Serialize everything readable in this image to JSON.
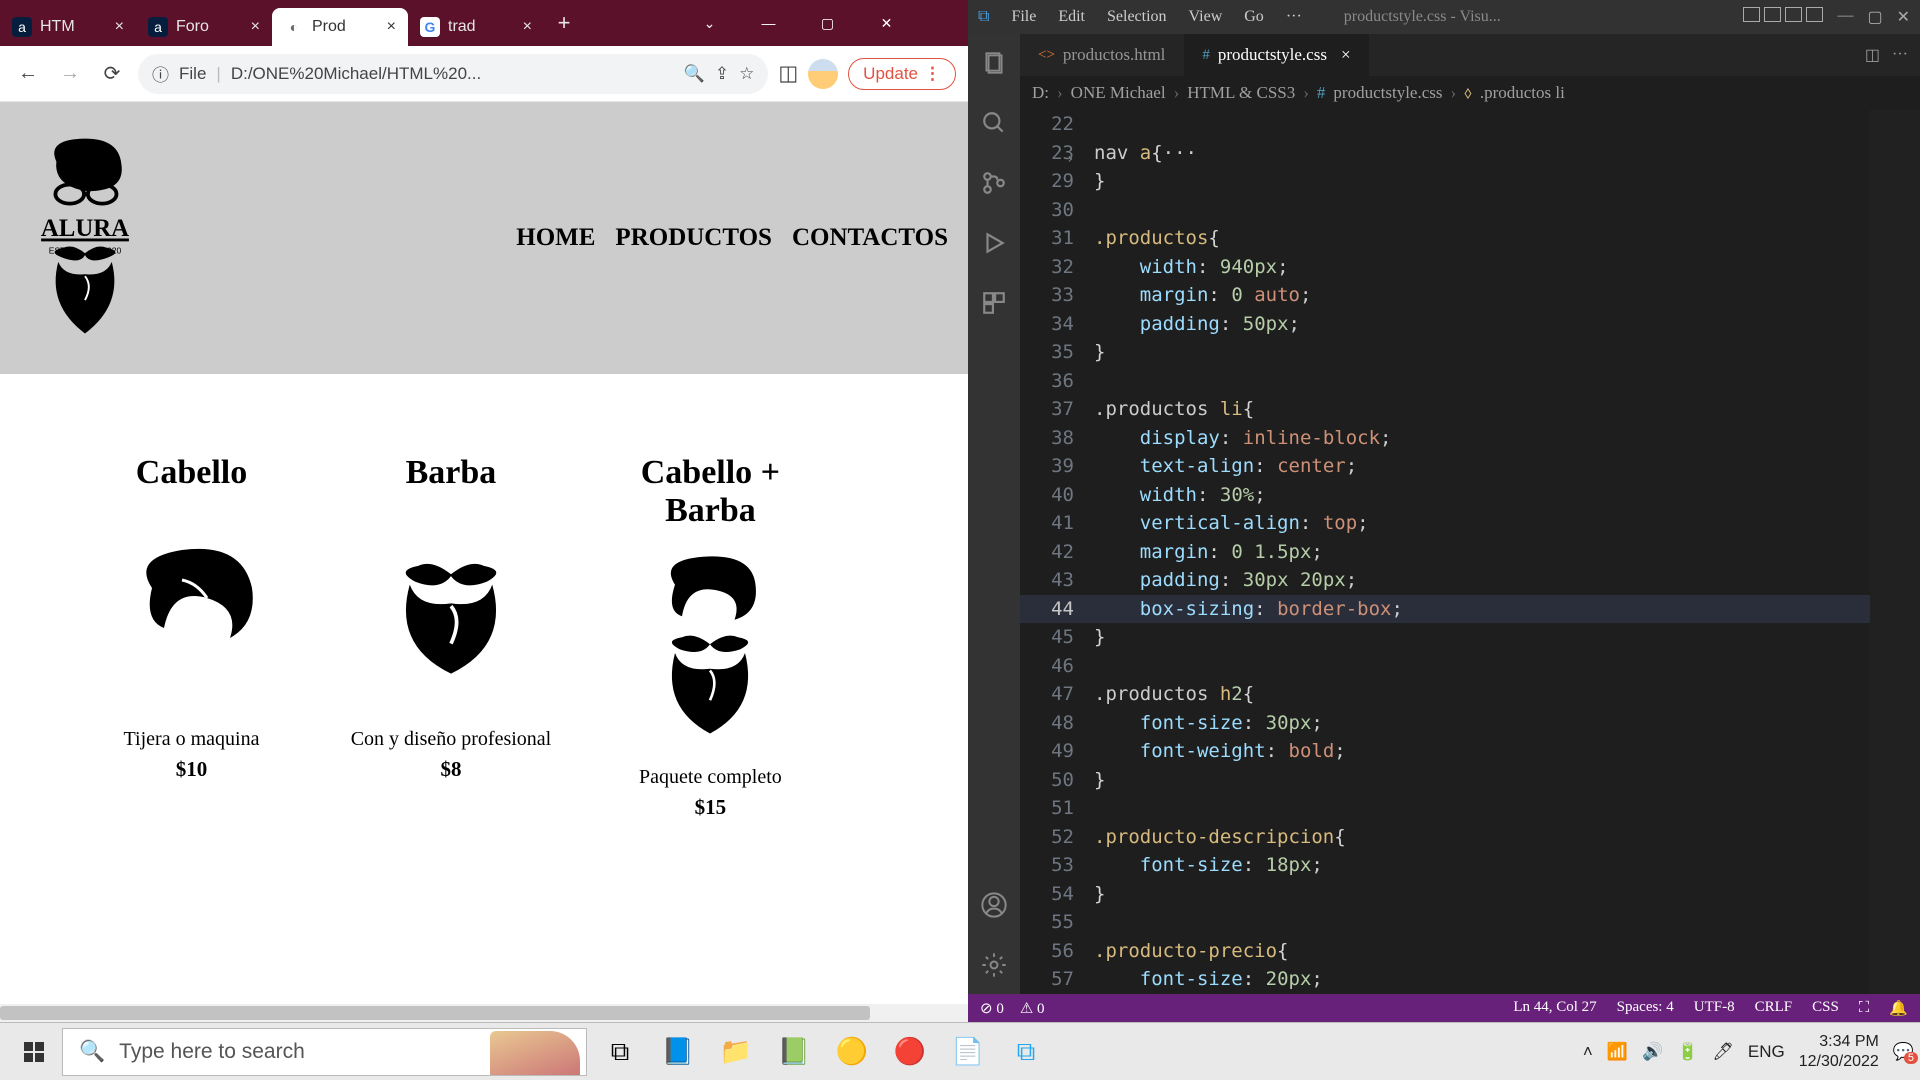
{
  "browser": {
    "tabs": [
      {
        "label": "HTM",
        "fav": "a"
      },
      {
        "label": "Foro",
        "fav": "a"
      },
      {
        "label": "Prod",
        "active": true,
        "fav": "◐"
      },
      {
        "label": "trad",
        "fav": "G"
      }
    ],
    "url_prefix": "File",
    "url": "D:/ONE%20Michael/HTML%20...",
    "update_label": "Update",
    "page": {
      "logo_text": "ALURA",
      "logo_est_left": "ESTD",
      "logo_est_right": "2020",
      "nav": [
        "HOME",
        "PRODUCTOS",
        "CONTACTOS"
      ],
      "products": [
        {
          "title": "Cabello",
          "desc": "Tijera o maquina",
          "price": "$10"
        },
        {
          "title": "Barba",
          "desc": "Con y diseño profesional",
          "price": "$8"
        },
        {
          "title": "Cabello + Barba",
          "desc": "Paquete completo",
          "price": "$15"
        }
      ]
    }
  },
  "vscode": {
    "menus": [
      "File",
      "Edit",
      "Selection",
      "View",
      "Go"
    ],
    "title": "productstyle.css - Visu...",
    "tabs": [
      {
        "label": "productos.html",
        "icon": "<>",
        "icon_color": "#e37933"
      },
      {
        "label": "productstyle.css",
        "icon": "#",
        "icon_color": "#519aba",
        "active": true
      }
    ],
    "breadcrumbs": [
      "D:",
      "ONE Michael",
      "HTML & CSS3",
      "productstyle.css",
      ".productos li"
    ],
    "code": [
      {
        "n": 22,
        "t": ""
      },
      {
        "n": 23,
        "t": "nav a{···",
        "fold": true
      },
      {
        "n": 29,
        "t": "}"
      },
      {
        "n": 30,
        "t": ""
      },
      {
        "n": 31,
        "t": ".productos{"
      },
      {
        "n": 32,
        "t": "    width: 940px;"
      },
      {
        "n": 33,
        "t": "    margin: 0 auto;"
      },
      {
        "n": 34,
        "t": "    padding: 50px;"
      },
      {
        "n": 35,
        "t": "}"
      },
      {
        "n": 36,
        "t": ""
      },
      {
        "n": 37,
        "t": ".productos li{"
      },
      {
        "n": 38,
        "t": "    display: inline-block;"
      },
      {
        "n": 39,
        "t": "    text-align: center;"
      },
      {
        "n": 40,
        "t": "    width: 30%;"
      },
      {
        "n": 41,
        "t": "    vertical-align: top;"
      },
      {
        "n": 42,
        "t": "    margin: 0 1.5px;"
      },
      {
        "n": 43,
        "t": "    padding: 30px 20px;"
      },
      {
        "n": 44,
        "t": "    box-sizing: border-box;",
        "current": true
      },
      {
        "n": 45,
        "t": "}"
      },
      {
        "n": 46,
        "t": ""
      },
      {
        "n": 47,
        "t": ".productos h2{"
      },
      {
        "n": 48,
        "t": "    font-size: 30px;"
      },
      {
        "n": 49,
        "t": "    font-weight: bold;"
      },
      {
        "n": 50,
        "t": "}"
      },
      {
        "n": 51,
        "t": ""
      },
      {
        "n": 52,
        "t": ".producto-descripcion{"
      },
      {
        "n": 53,
        "t": "    font-size: 18px;"
      },
      {
        "n": 54,
        "t": "}"
      },
      {
        "n": 55,
        "t": ""
      },
      {
        "n": 56,
        "t": ".producto-precio{"
      },
      {
        "n": 57,
        "t": "    font-size: 20px;"
      }
    ],
    "status": {
      "left": [
        "⊘ 0",
        "⚠ 0"
      ],
      "right": [
        "Ln 44, Col 27",
        "Spaces: 4",
        "UTF-8",
        "CRLF",
        "CSS"
      ]
    }
  },
  "taskbar": {
    "search_placeholder": "Type here to search",
    "tray_lang": "ENG",
    "time": "3:34 PM",
    "date": "12/30/2022"
  }
}
